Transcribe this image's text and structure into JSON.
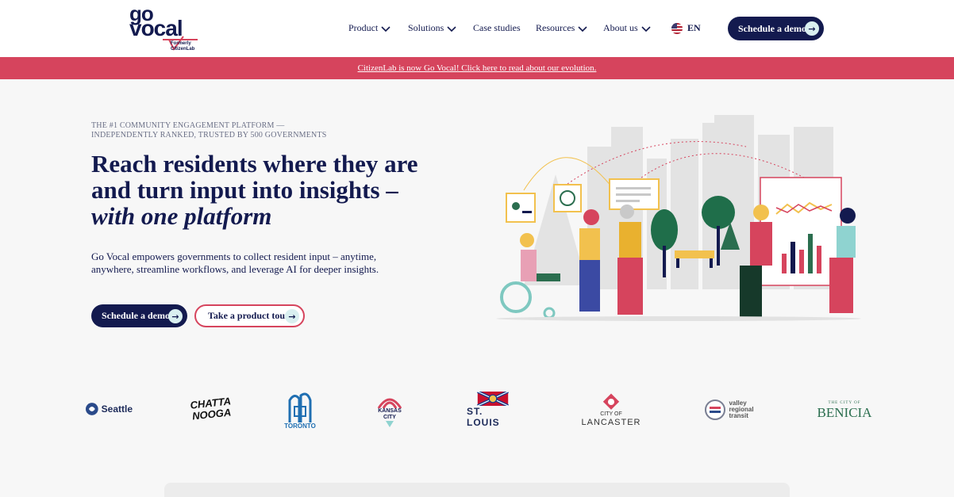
{
  "logo": {
    "go": "go",
    "vocal": "vocal",
    "formerly_line1": "Formerly",
    "formerly_line2": "CitizenLab"
  },
  "nav": {
    "items": [
      {
        "label": "Product",
        "dropdown": true
      },
      {
        "label": "Solutions",
        "dropdown": true
      },
      {
        "label": "Case studies",
        "dropdown": false
      },
      {
        "label": "Resources",
        "dropdown": true
      },
      {
        "label": "About us",
        "dropdown": true
      }
    ],
    "language": "EN",
    "language_icon": "us-flag-icon",
    "cta_label": "Schedule a demo"
  },
  "banner": {
    "text": "CitizenLab is now Go Vocal! Click here to read about our evolution."
  },
  "hero": {
    "eyebrow": "THE #1 COMMUNITY ENGAGEMENT PLATFORM — INDEPENDENTLY RANKED, TRUSTED BY 500 GOVERNMENTS",
    "headline_plain": "Reach residents where they are and turn input into insights – ",
    "headline_emphasis": "with one platform",
    "subcopy": "Go Vocal empowers governments to collect resident input – anytime, anywhere, streamline workflows, and leverage AI for deeper insights.",
    "primary_cta": "Schedule a demo",
    "secondary_cta": "Take a product tour"
  },
  "client_logos": {
    "seattle": "Seattle",
    "chattanooga_1": "CHATTA",
    "chattanooga_2": "NOOGA",
    "toronto": "TORONTO",
    "kansas_city_1": "KANSAS",
    "kansas_city_2": "CITY",
    "st_louis": "ST. LOUIS",
    "lancaster_1": "CITY OF",
    "lancaster_2": "LANCASTER",
    "valley_1": "valley",
    "valley_2": "regional",
    "valley_3": "transit",
    "benicia_1": "THE CITY OF",
    "benicia_2": "BENICIA"
  },
  "colors": {
    "navy": "#131a4f",
    "brand_red": "#d6445d",
    "mint": "#d9eff0",
    "background": "#f7f7f7"
  }
}
